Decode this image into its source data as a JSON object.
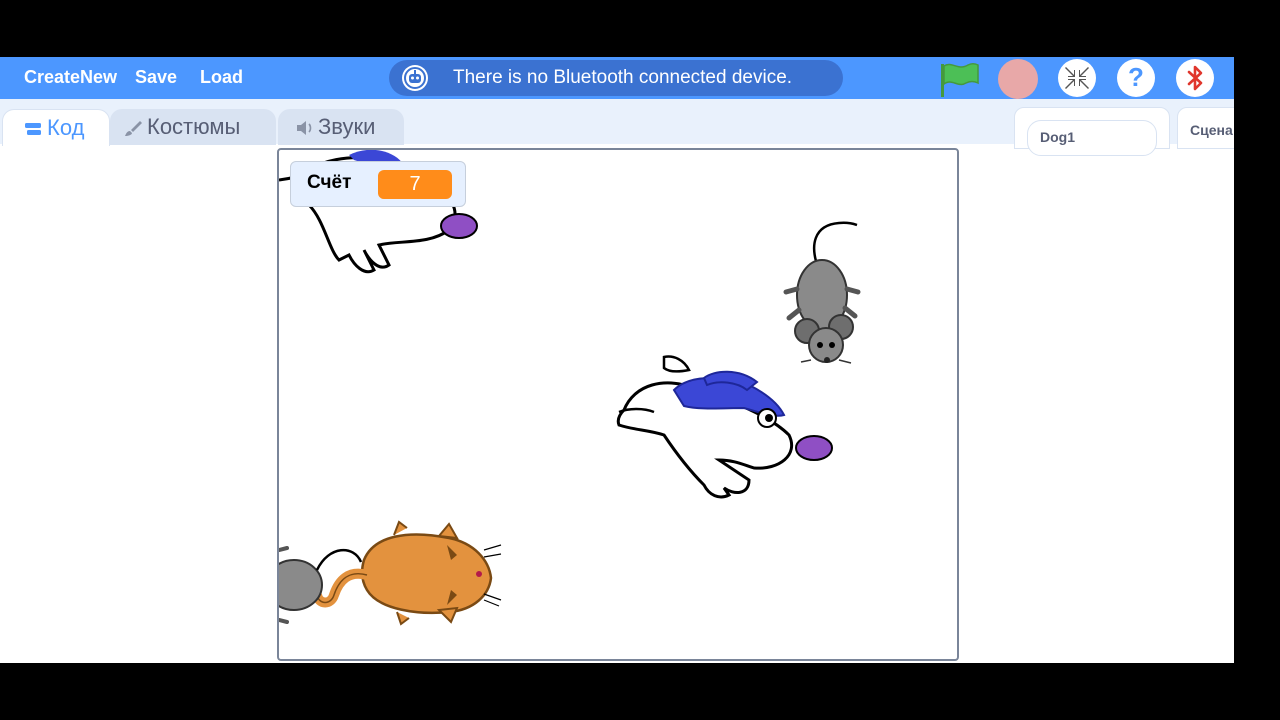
{
  "menubar": {
    "create_new": "CreateNew",
    "save": "Save",
    "load": "Load",
    "bluetooth_message": "There is no Bluetooth connected device.",
    "green_flag_icon": "green-flag-icon",
    "stop_icon": "stop-icon",
    "fullscreen_icon": "shrink-arrows-icon",
    "help_label": "?",
    "bluetooth_icon": "bluetooth-icon",
    "accent_color": "#4c97ff",
    "banner_color": "#3b72d1"
  },
  "tabs": {
    "code": "Код",
    "costumes": "Костюмы",
    "sounds": "Звуки",
    "active": "code"
  },
  "sprites": {
    "selected_sprite": "Dog1",
    "stage_tab": "Сцена"
  },
  "stage": {
    "variable_monitor": {
      "name": "Счёт",
      "value": "7",
      "value_color": "#ff8c1a"
    },
    "characters": [
      "dog",
      "dog",
      "mouse",
      "mouse",
      "cat"
    ]
  }
}
